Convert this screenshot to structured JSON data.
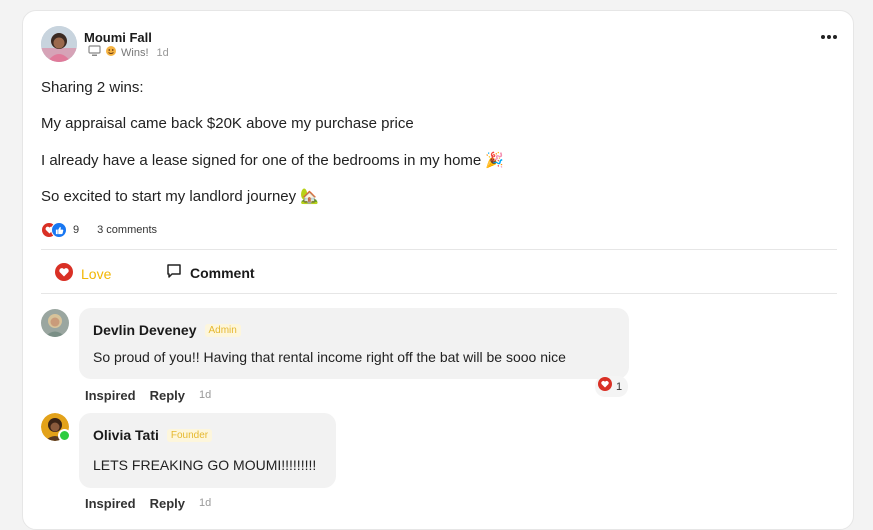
{
  "post": {
    "author": "Moumi Fall",
    "category": "Wins!",
    "time": "1d",
    "lines": [
      "Sharing 2 wins:",
      "My appraisal came back $20K above my purchase price",
      "I already have a lease signed for one of the bedrooms in my home 🎉",
      "So excited to start my landlord journey 🏡"
    ],
    "reaction_count": "9",
    "comments_count": "3 comments"
  },
  "actions": {
    "love_label": "Love",
    "comment_label": "Comment"
  },
  "comments": [
    {
      "name": "Devlin Deveney",
      "badge": "Admin",
      "text": "So proud of you!! Having that rental income right off the bat will be sooo nice",
      "inspired": "Inspired",
      "reply": "Reply",
      "time": "1d",
      "reaction_count": "1"
    },
    {
      "name": "Olivia Tati",
      "badge": "Founder",
      "text": "LETS FREAKING GO MOUMI!!!!!!!!!",
      "inspired": "Inspired",
      "reply": "Reply",
      "time": "1d"
    }
  ],
  "colors": {
    "love": "#f2b705",
    "heart": "#d93025",
    "like_blue": "#1877f2",
    "badge_text": "#e5b82f",
    "online": "#2ecc40"
  },
  "icons": {
    "more": "three-dots-icon",
    "heart": "heart-icon",
    "comment": "speech-bubble-icon",
    "device": "monitor-icon",
    "category": "emoji-icon"
  }
}
